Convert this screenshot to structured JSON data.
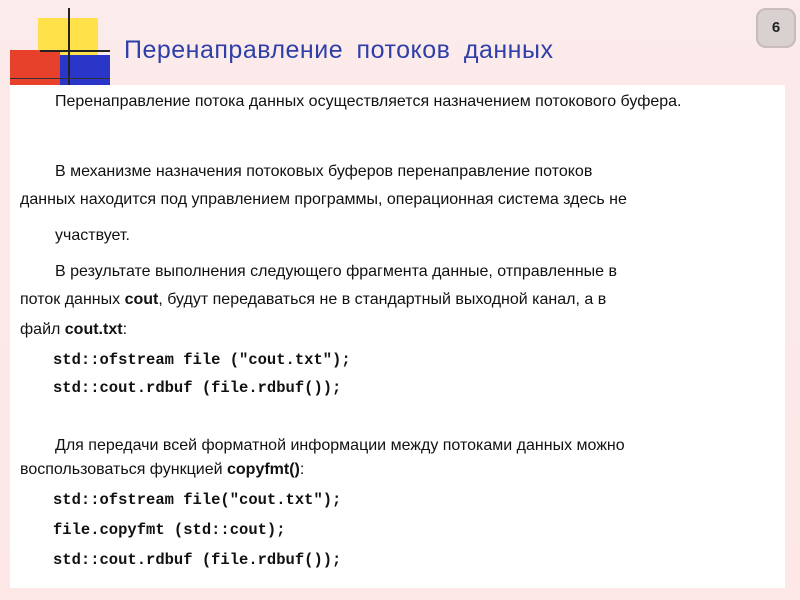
{
  "slide": {
    "title": "Перенаправление  потоков  данных",
    "page_number": "6"
  },
  "content": {
    "p1": "Перенаправление потока данных осуществляется назначением потокового буфера.",
    "p2_line1": "В механизме назначения потоковых буферов перенаправление потоков",
    "p2_line2": "данных находится под управлением программы, операционная система здесь не",
    "p2_line3": "участвует.",
    "p3_line1": "В результате выполнения следующего фрагмента данные, отправленные в",
    "p3_line2_a": "поток данных ",
    "p3_line2_b": "cout",
    "p3_line2_c": ", будут передаваться не в стандартный выходной канал, а в",
    "p3_line3_a": "файл ",
    "p3_line3_b": "cout.txt",
    "p3_line3_c": ":",
    "code1": [
      "std::ofstream file (\"cout.txt\");",
      "std::cout.rdbuf (file.rdbuf());"
    ],
    "p4_line1": "Для передачи всей форматной информации между потоками данных можно",
    "p4_line2_a": "воспользоваться функцией ",
    "p4_line2_b": "copyfmt()",
    "p4_line2_c": ":",
    "code2": [
      "std::ofstream file(\"cout.txt\");",
      "file.copyfmt (std::cout);",
      "std::cout.rdbuf (file.rdbuf());"
    ]
  },
  "colors": {
    "title": "#2f3fa8",
    "background": "#fdeaea",
    "logo_yellow": "#ffe14a",
    "logo_red": "#e8412b",
    "logo_blue": "#2a36c8"
  }
}
